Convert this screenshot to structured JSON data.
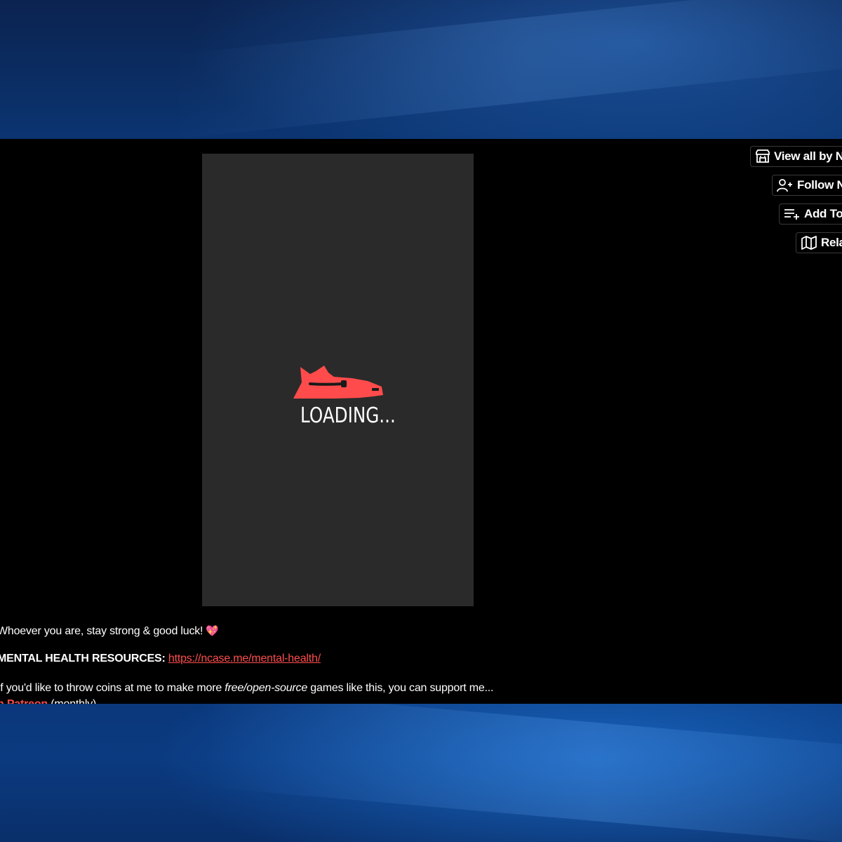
{
  "desktop": {
    "accent": "#0b3a80"
  },
  "game": {
    "loading_text": "LOADING...",
    "frame_color": "#2a2a2a",
    "loader_color": "#ff4b4b"
  },
  "sidebar_buttons": {
    "view_all": "View all by N",
    "follow": "Follow N",
    "add_to": "Add To",
    "related": "Rela"
  },
  "description": {
    "line1_text": "hoever you are, stay strong & good luck!",
    "line1_prefix": "W",
    "heart_icon": "sparkling-heart-icon",
    "line2_label": "ENTAL HEALTH RESOURCES:",
    "line2_prefix": "M",
    "line2_link": "https://ncase.me/mental-health/",
    "line3_start": "you'd like to throw coins at me to make more ",
    "line3_prefix": "If",
    "line3_italic": "free/open-source",
    "line3_end": " games like this, you can support me...",
    "line4_link": "n Patreon",
    "line4_rest": " (monthly)"
  },
  "colors": {
    "link": "#ff4d4d",
    "background": "#000000",
    "text": "#ffffff"
  }
}
